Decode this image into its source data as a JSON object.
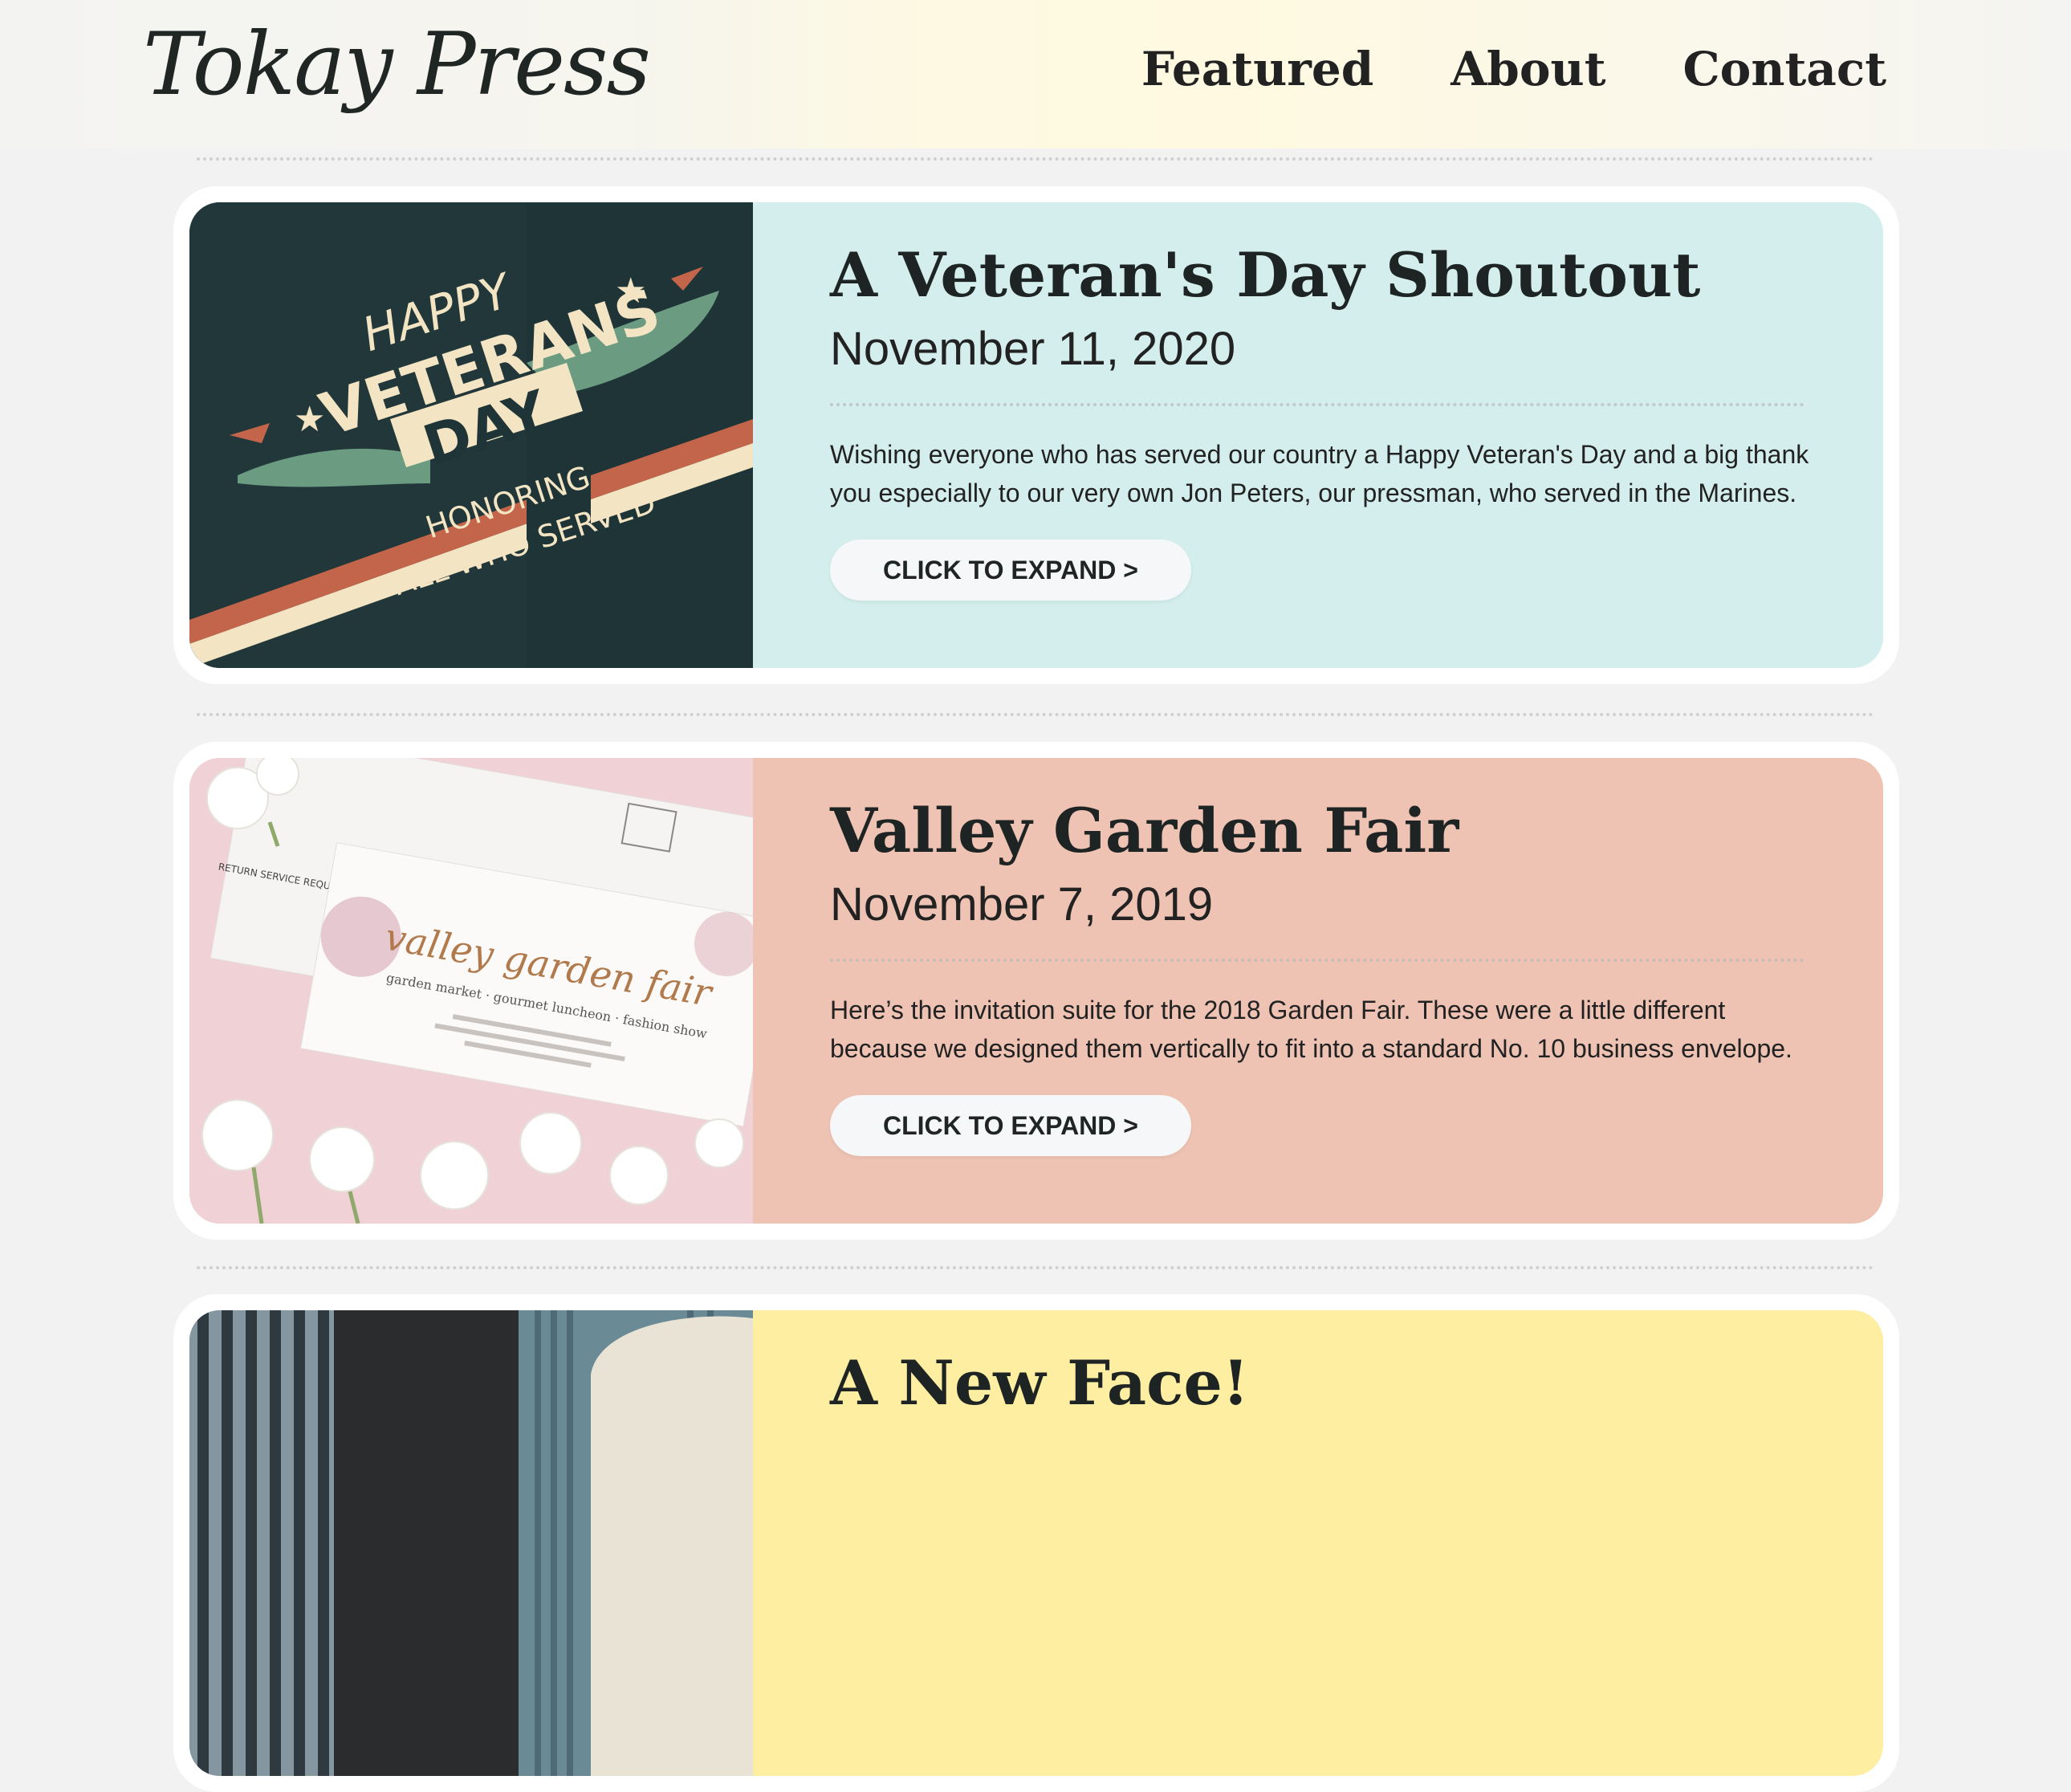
{
  "header": {
    "logo": "Tokay Press",
    "nav": [
      "Featured",
      "About",
      "Contact"
    ]
  },
  "posts": [
    {
      "title": "A Veteran's Day Shoutout",
      "date": "November 11, 2020",
      "text": "Wishing everyone who has served our country a Happy Veteran's Day and a big thank you especially to our very own Jon Peters, our pressman, who served in the Marines.",
      "button": "CLICK TO EXPAND >",
      "color": "#d3eeec",
      "image": {
        "line1": "HAPPY",
        "line2": "VETERANS",
        "line3": "DAY",
        "line4": "HONORING",
        "line5": "ALL WHO SERVED"
      }
    },
    {
      "title": "Valley Garden Fair",
      "date": "November 7, 2019",
      "text": "Here’s the invitation suite for the 2018 Garden Fair. These were a little different because we designed them vertically to fit into a standard No. 10 business envelope.",
      "button": "CLICK TO EXPAND >",
      "color": "#eec3b3",
      "image": {
        "script": "valley garden fair",
        "subtitle": "garden market · gourmet luncheon · fashion show",
        "return": "RETURN SERVICE REQUESTED"
      }
    },
    {
      "title": "A New Face!",
      "color": "#fdeea1"
    }
  ]
}
